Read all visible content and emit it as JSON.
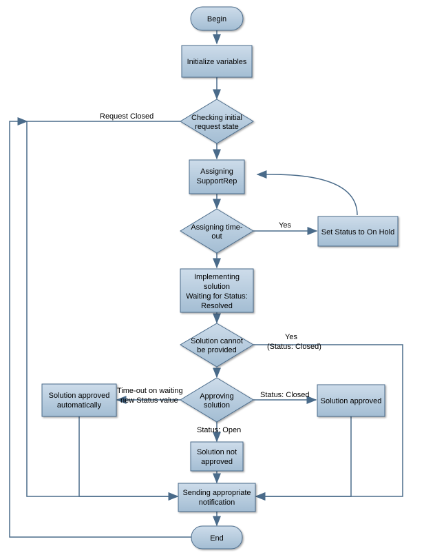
{
  "nodes": {
    "begin": {
      "label": "Begin"
    },
    "init": {
      "label": "Initialize variables"
    },
    "check_initial": {
      "line1": "Checking initial",
      "line2": "request state"
    },
    "assign_rep": {
      "line1": "Assigning",
      "line2": "SupportRep"
    },
    "assign_timeout": {
      "line1": "Assigning time-",
      "line2": "out"
    },
    "set_onhold": {
      "label": "Set Status to On Hold"
    },
    "implement": {
      "line1": "Implementing",
      "line2": "solution",
      "line3": "Waiting for Status:",
      "line4": "Resolved"
    },
    "solution_cannot": {
      "line1": "Solution cannot",
      "line2": "be provided"
    },
    "approving": {
      "line1": "Approving",
      "line2": "solution"
    },
    "sol_auto": {
      "line1": "Solution approved",
      "line2": "automatically"
    },
    "sol_approved": {
      "label": "Solution approved"
    },
    "sol_not": {
      "line1": "Solution not",
      "line2": "approved"
    },
    "sending": {
      "line1": "Sending appropriate",
      "line2": "notification"
    },
    "end": {
      "label": "End"
    }
  },
  "edges": {
    "request_closed": "Request Closed",
    "timeout_yes": "Yes",
    "cannot_yes1": "Yes",
    "cannot_yes2": "(Status: Closed)",
    "approve_closed": "Status: Closed",
    "approve_timeout1": "Time-out on waiting",
    "approve_timeout2": "new Status value",
    "approve_open": "Status: Open"
  },
  "colors": {
    "fill_light": "#c5d6e6",
    "fill_dark": "#9fb9d0",
    "stroke": "#4a6b8a",
    "arrow": "#4a6b8a"
  }
}
